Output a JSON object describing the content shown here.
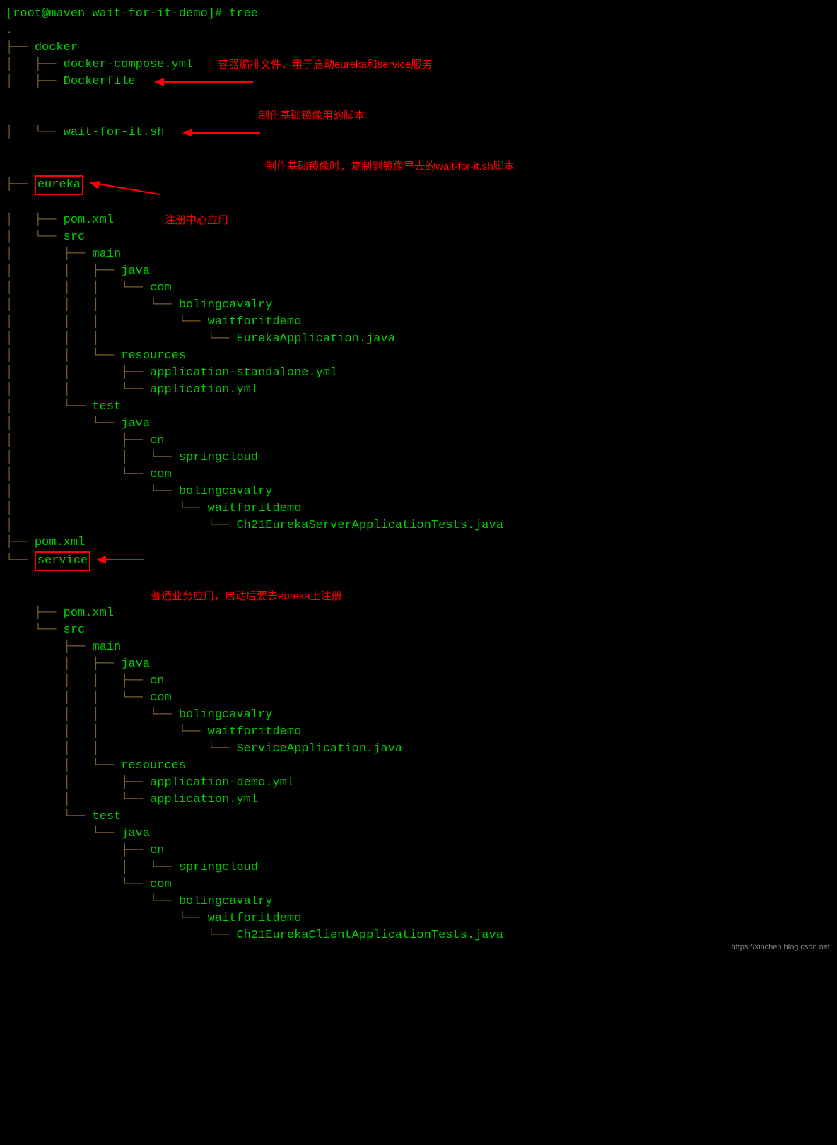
{
  "prompt": "[root@maven wait-for-it-demo]# tree",
  "root_dot": ".",
  "tree": {
    "docker": "docker",
    "docker_compose": "docker-compose.yml",
    "dockerfile": "Dockerfile",
    "wait_for_it": "wait-for-it.sh",
    "eureka": "eureka",
    "eureka_pom": "pom.xml",
    "eureka_src": "src",
    "eureka_main": "main",
    "eureka_main_java": "java",
    "eureka_main_com": "com",
    "eureka_main_bc": "bolingcavalry",
    "eureka_main_wfd": "waitforitdemo",
    "eureka_app": "EurekaApplication.java",
    "eureka_resources": "resources",
    "eureka_app_standalone": "application-standalone.yml",
    "eureka_app_yml": "application.yml",
    "eureka_test": "test",
    "eureka_test_java": "java",
    "eureka_test_cn": "cn",
    "eureka_test_springcloud": "springcloud",
    "eureka_test_com": "com",
    "eureka_test_bc": "bolingcavalry",
    "eureka_test_wfd": "waitforitdemo",
    "eureka_test_class": "Ch21EurekaServerApplicationTests.java",
    "root_pom": "pom.xml",
    "service": "service",
    "service_pom": "pom.xml",
    "service_src": "src",
    "service_main": "main",
    "service_main_java": "java",
    "service_main_cn": "cn",
    "service_main_com": "com",
    "service_main_bc": "bolingcavalry",
    "service_main_wfd": "waitforitdemo",
    "service_app": "ServiceApplication.java",
    "service_resources": "resources",
    "service_app_demo": "application-demo.yml",
    "service_app_yml": "application.yml",
    "service_test": "test",
    "service_test_java": "java",
    "service_test_cn": "cn",
    "service_test_springcloud": "springcloud",
    "service_test_com": "com",
    "service_test_bc": "bolingcavalry",
    "service_test_wfd": "waitforitdemo",
    "service_test_class": "Ch21EurekaClientApplicationTests.java"
  },
  "annotations": {
    "compose": "容器编排文件，用于启动eureka和service服务",
    "dockerfile": "制作基础镜像用的脚本",
    "wait_for_it": "制作基础镜像时，复制到镜像里去的wait-for-it.sh脚本",
    "eureka": "注册中心应用",
    "service": "普通业务应用，启动后要去eureka上注册"
  },
  "watermark": "https://xinchen.blog.csdn.net"
}
